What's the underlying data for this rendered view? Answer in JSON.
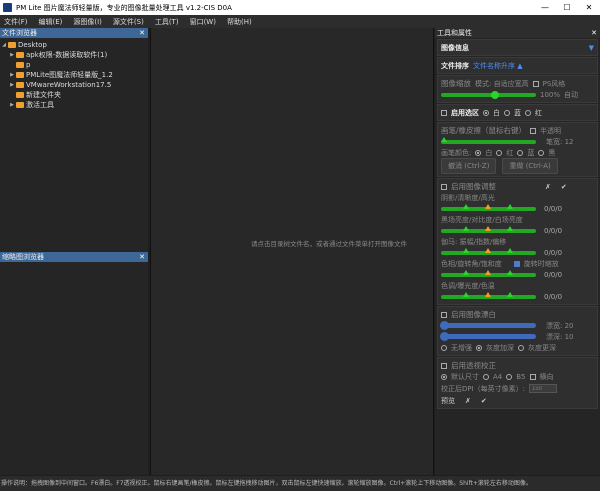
{
  "window": {
    "title": "PM Lite 图片魔法师轻量版，专业的图像批量处理工具 v1.2-CIS D0A",
    "minimize": "—",
    "maximize": "☐",
    "close": "✕"
  },
  "menu": [
    "文件(F)",
    "编辑(E)",
    "源图像(I)",
    "源文件(S)",
    "工具(T)",
    "窗口(W)",
    "帮助(H)"
  ],
  "file_browser": {
    "title": "文件浏览器",
    "close": "✕",
    "root": "Desktop",
    "items": [
      {
        "label": "apk权限-数据读取软件(1)",
        "expandable": true
      },
      {
        "label": "p",
        "expandable": false
      },
      {
        "label": "PMLite图魔法师轻量版_1.2",
        "expandable": true
      },
      {
        "label": "VMwareWorkstation17.5",
        "expandable": true
      },
      {
        "label": "新建文件夹",
        "expandable": false
      },
      {
        "label": "激活工具",
        "expandable": true
      }
    ]
  },
  "thumbnail_browser": {
    "title": "缩略图浏览器",
    "close": "✕"
  },
  "center": {
    "hint": "请点击目录树文件名，或者通过文件菜单打开图像文件"
  },
  "tools": {
    "title": "工具和属性",
    "close": "✕",
    "image_info": {
      "label": "图像信息",
      "icon": "▼"
    },
    "sort": {
      "label": "文件排序",
      "value": "文件名称升序 ▲"
    },
    "zoom": {
      "label": "图像缩放",
      "mode": "模式: 自适应宽高",
      "ps_style": "PS风格",
      "percent": "100%",
      "auto": "自动",
      "value_percent": 55
    },
    "selection": {
      "label": "启用选区",
      "options": [
        "白",
        "蓝",
        "红"
      ],
      "selected": 0
    },
    "brush": {
      "label": "画笔/橡皮擦（鼠标右键）",
      "translucent": "半透明",
      "width_label": "笔宽: 12",
      "width": 12,
      "color_label": "画笔颜色:",
      "colors": [
        "白",
        "红",
        "蓝",
        "黑"
      ],
      "selected": 0,
      "undo": "撤消 (Ctrl-Z)",
      "redo": "重做 (Ctrl-A)"
    },
    "adjust": {
      "label": "启用图像调整",
      "cancel": "✗",
      "ok": "✔",
      "rows": [
        {
          "label": "阴影/清晰度/高光",
          "value": "0/0/0"
        },
        {
          "label": "黑场亮度/对比度/白场亮度",
          "value": "0/0/0"
        },
        {
          "label": "伽马: 振幅/指数/偏移",
          "value": "0/0/0"
        },
        {
          "label": "色相/旋转角/饱和度",
          "value": "0/0/0",
          "extra": "旋转时缩放"
        },
        {
          "label": "色调/曝光度/色温",
          "value": "0/0/0"
        }
      ]
    },
    "bleach": {
      "label": "启用图像漂白",
      "range_label": "漂宽: 20",
      "range": 20,
      "depth_label": "漂深: 10",
      "depth": 10,
      "options": [
        "无增强",
        "灰度加深",
        "灰度更深"
      ],
      "selected": 1
    },
    "perspective": {
      "label": "启用透视校正",
      "sizes": [
        "默认尺寸",
        "A4",
        "B5"
      ],
      "selected": 0,
      "landscape": "横向",
      "dpi_label": "校正后DPI（每英寸像素）:",
      "dpi": "150",
      "preview": "预览",
      "cancel": "✗",
      "ok": "✔"
    }
  },
  "status": "操作说明：拖拽图像到中间窗口。F6漂白。F7透视校正。鼠标右键画笔/橡皮擦。鼠标左键拖拽移动图片，双击鼠标左键快速缩放。滚轮缩放图像。Ctrl+滚轮上下移动图像。Shift+滚轮左右移动图像。"
}
